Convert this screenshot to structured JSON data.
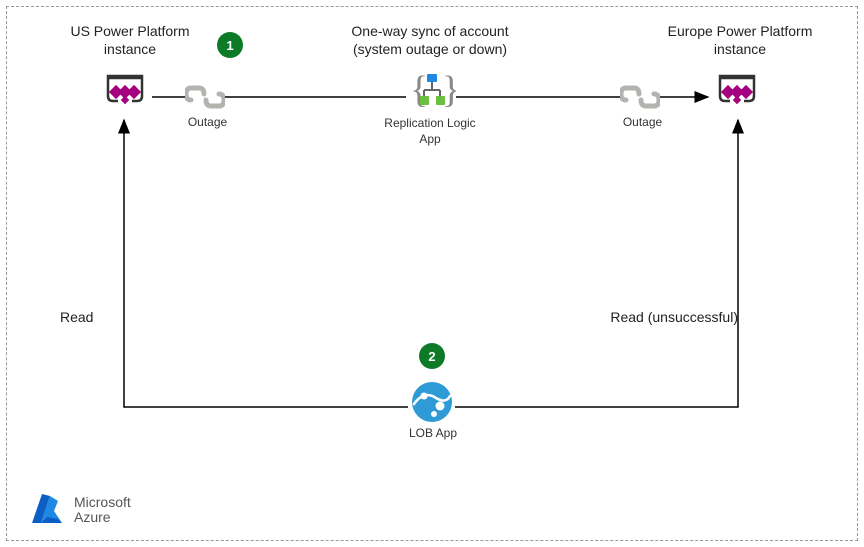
{
  "diagram": {
    "nodes": {
      "us": {
        "title_line1": "US Power Platform",
        "title_line2": "instance"
      },
      "europe": {
        "title_line1": "Europe Power Platform",
        "title_line2": "instance"
      },
      "sync": {
        "title_line1": "One-way sync of account",
        "title_line2": "(system outage or down)",
        "caption_line1": "Replication Logic",
        "caption_line2": "App"
      },
      "lob": {
        "caption": "LOB App"
      },
      "outage_left": {
        "label": "Outage"
      },
      "outage_right": {
        "label": "Outage"
      }
    },
    "edges": {
      "read_left": "Read",
      "read_right": "Read (unsuccessful)"
    },
    "badges": {
      "one": "1",
      "two": "2"
    }
  },
  "brand": {
    "line1": "Microsoft",
    "line2": "Azure"
  }
}
